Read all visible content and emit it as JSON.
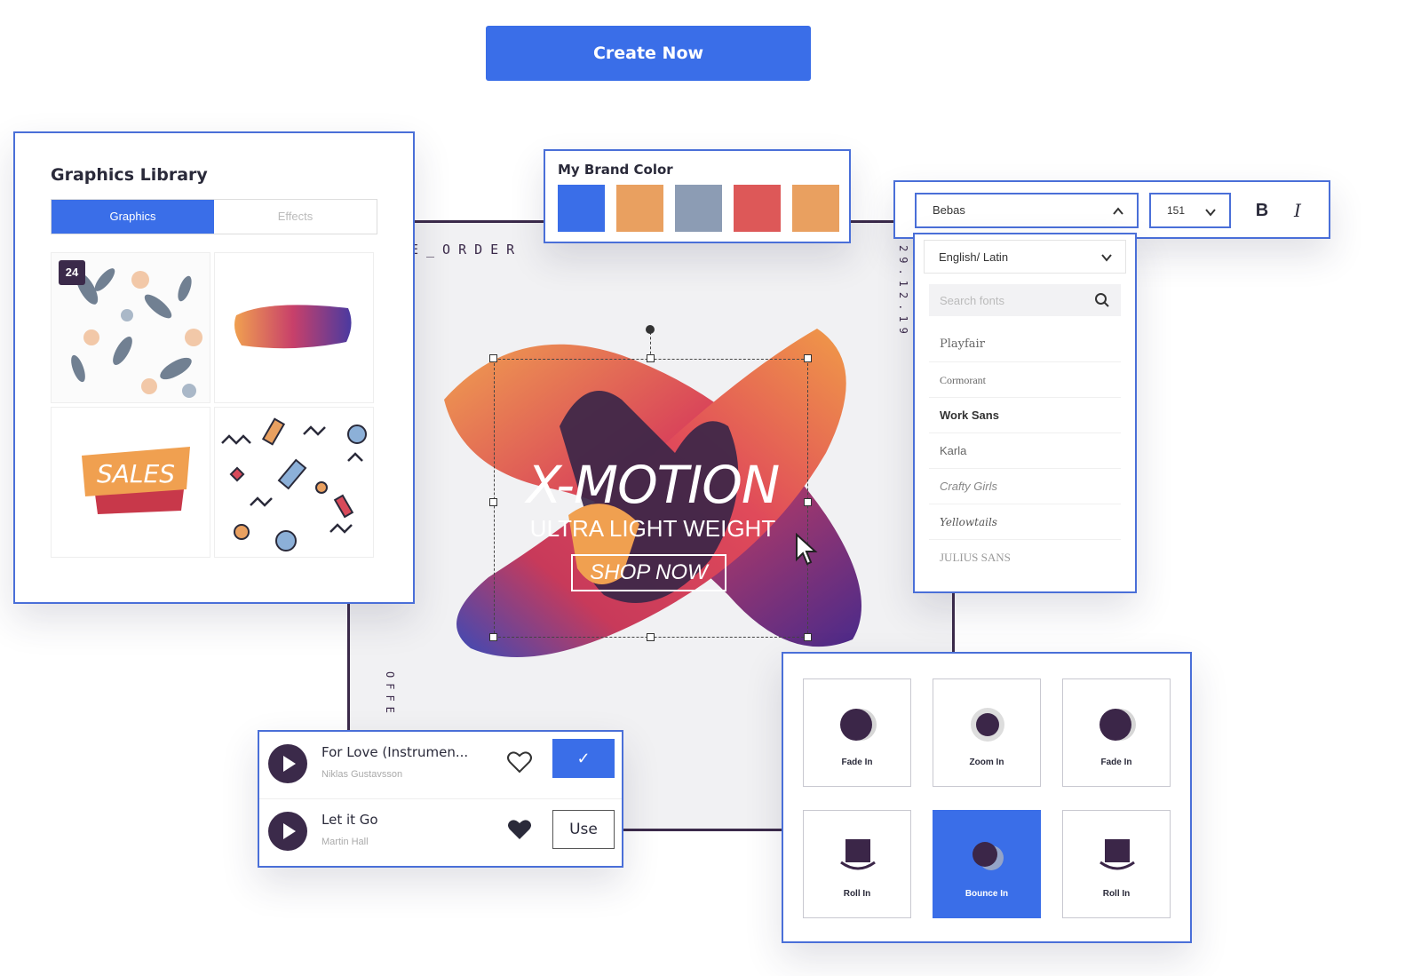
{
  "header": {
    "create_label": "Create Now"
  },
  "poster": {
    "side_top": "E_ORDER",
    "side_right": "29.12.19",
    "side_left": "OFFE",
    "title": "X-MOTION",
    "subtitle": "ULTRA LIGHT WEIGHT",
    "cta": "SHOP NOW"
  },
  "graphics": {
    "title": "Graphics Library",
    "tabs": [
      {
        "label": "Graphics"
      },
      {
        "label": "Effects"
      }
    ],
    "badge": "24",
    "sales_text": "SALES"
  },
  "brand": {
    "title": "My Brand Color",
    "colors": [
      "#3a6ee8",
      "#e9a060",
      "#8c9cb4",
      "#dd5858",
      "#e9a060"
    ]
  },
  "font_toolbar": {
    "font_value": "Bebas",
    "size_value": "151",
    "bold_label": "B",
    "italic_label": "I"
  },
  "font_dropdown": {
    "language": "English/ Latin",
    "search_placeholder": "Search fonts",
    "fonts": [
      "Playfair",
      "Cormorant",
      "Work Sans",
      "Karla",
      "Crafty Girls",
      "Yellowtails",
      "JULIUS SANS"
    ]
  },
  "music": {
    "tracks": [
      {
        "title": "For Love (Instrumen...",
        "artist": "Niklas Gustavsson"
      },
      {
        "title": "Let it Go",
        "artist": "Martin Hall"
      }
    ],
    "use_label": "Use"
  },
  "animations": {
    "items": [
      {
        "label": "Fade In"
      },
      {
        "label": "Zoom In"
      },
      {
        "label": "Fade In"
      },
      {
        "label": "Roll In"
      },
      {
        "label": "Bounce In"
      },
      {
        "label": "Roll In"
      }
    ]
  }
}
